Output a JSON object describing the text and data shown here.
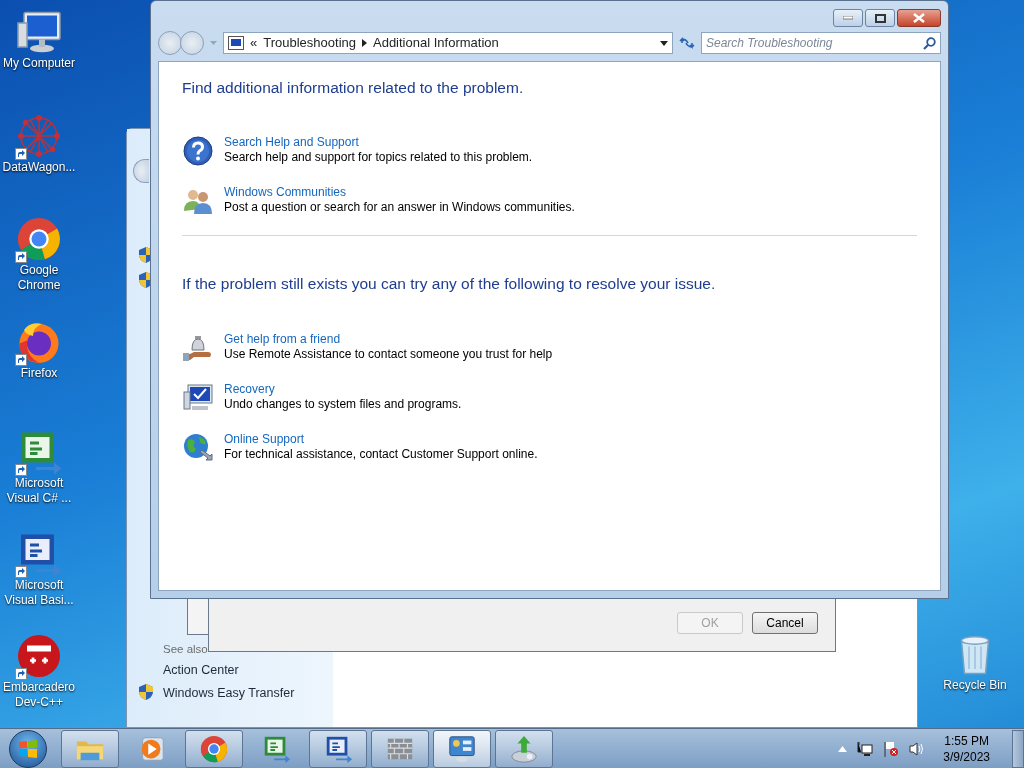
{
  "desktop_icons": [
    {
      "label": "My Computer",
      "kind": "computer",
      "shortcut": false
    },
    {
      "label": "DataWagon...",
      "kind": "network",
      "shortcut": true
    },
    {
      "label": "Google Chrome",
      "kind": "chrome",
      "shortcut": true
    },
    {
      "label": "Firefox",
      "kind": "firefox",
      "shortcut": true
    },
    {
      "label": "Microsoft Visual C# ...",
      "kind": "csharp",
      "shortcut": true
    },
    {
      "label": "Microsoft Visual Basi...",
      "kind": "vb",
      "shortcut": true
    },
    {
      "label": "Embarcadero Dev-C++",
      "kind": "devcpp",
      "shortcut": true
    }
  ],
  "recycle_bin": {
    "label": "Recycle Bin"
  },
  "back_window": {
    "see_also": "See also",
    "links": [
      {
        "label": "Action Center",
        "shield": false
      },
      {
        "label": "Windows Easy Transfer",
        "shield": true
      }
    ]
  },
  "dialog": {
    "buttons": [
      {
        "label": "OK",
        "disabled": true
      },
      {
        "label": "Cancel",
        "disabled": false
      }
    ]
  },
  "window": {
    "breadcrumb": {
      "overflow": "«",
      "items": [
        "Troubleshooting",
        "Additional Information"
      ]
    },
    "search": {
      "placeholder": "Search Troubleshooting"
    },
    "sections": [
      {
        "heading": "Find additional information related to the problem.",
        "items": [
          {
            "kind": "help",
            "title": "Search Help and Support",
            "description": "Search help and support for topics related to this problem."
          },
          {
            "kind": "people",
            "title": "Windows Communities",
            "description": "Post a question or search for an answer in Windows communities."
          }
        ]
      },
      {
        "heading": "If the problem still exists you can try any of the following to resolve your issue.",
        "items": [
          {
            "kind": "friend",
            "title": "Get help from a friend",
            "description": "Use Remote Assistance to contact someone you trust for help"
          },
          {
            "kind": "recovery",
            "title": "Recovery",
            "description": "Undo changes to system files and programs."
          },
          {
            "kind": "online",
            "title": "Online Support",
            "description": "For technical assistance, contact Customer Support online."
          }
        ]
      }
    ]
  },
  "taskbar": {
    "apps": [
      {
        "kind": "explorer",
        "running": true,
        "selected": false
      },
      {
        "kind": "media",
        "running": false,
        "selected": false
      },
      {
        "kind": "chrome",
        "running": true,
        "selected": false
      },
      {
        "kind": "csharp",
        "running": false,
        "selected": false
      },
      {
        "kind": "vb",
        "running": true,
        "selected": false
      },
      {
        "kind": "firewall",
        "running": true,
        "selected": false
      },
      {
        "kind": "control",
        "running": true,
        "selected": true
      },
      {
        "kind": "installer",
        "running": true,
        "selected": false
      }
    ],
    "clock": {
      "time": "1:55 PM",
      "date": "3/9/2023"
    }
  }
}
